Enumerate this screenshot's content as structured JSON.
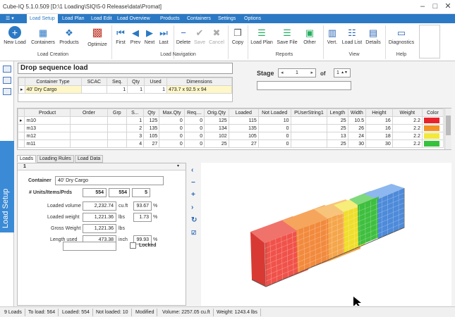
{
  "window": {
    "title": "Cube-IQ  5.1.0.509  [D:\\1 Loading\\SIQ\\5-0 Release\\data\\Promat]"
  },
  "tabs": [
    "Load Setup",
    "Load Plan",
    "Load Edit",
    "Load Overview",
    "Products",
    "Containers",
    "Settings",
    "Options"
  ],
  "ribbon": {
    "new_load": "New Load",
    "containers": "Containers",
    "products": "Products",
    "optimize": "Optimize",
    "first": "First",
    "prev": "Prev",
    "next": "Next",
    "last": "Last",
    "delete": "Delete",
    "save": "Save",
    "cancel": "Cancel",
    "copy": "Copy",
    "load_plan": "Load Plan",
    "save_file": "Save File",
    "other": "Other",
    "vert": "Vert.",
    "load_list": "Load List",
    "details": "Details",
    "diagnostics": "Diagnostics",
    "groups": {
      "load_creation": "Load Creation",
      "load_navigation": "Load Navigation",
      "reports": "Reports",
      "view": "View",
      "help": "Help"
    }
  },
  "sidebar": {
    "label": "Load Setup"
  },
  "sequence": {
    "title": "Drop sequence load",
    "stage_label": "Stage",
    "stage_value": "1",
    "of_label": "of",
    "of_value": "1"
  },
  "container_table": {
    "headers": [
      "Container Type",
      "SCAC",
      "Seq.",
      "Qty",
      "Used",
      "Dimensions"
    ],
    "rows": [
      [
        "40' Dry Cargo",
        "",
        "1",
        "1",
        "1",
        "473.7 x 92.5 x 94"
      ]
    ]
  },
  "product_table": {
    "headers": [
      "Product",
      "Order",
      "Grp",
      "S...",
      "Qty",
      "Max.Qty",
      "Req....",
      "Orig.Qty",
      "Loaded",
      "Not Loaded",
      "PUserString1",
      "Length",
      "Width",
      "Height",
      "Weight",
      "Color"
    ],
    "rows": [
      {
        "product": "m10",
        "order": "",
        "grp": "",
        "s": "1",
        "qty": "125",
        "maxqty": "0",
        "req": "0",
        "orig": "125",
        "loaded": "115",
        "notloaded": "10",
        "pus": "",
        "length": "25",
        "width": "10.5",
        "height": "16",
        "weight": "2.2",
        "color": "#e8232a"
      },
      {
        "product": "m13",
        "order": "",
        "grp": "",
        "s": "2",
        "qty": "135",
        "maxqty": "0",
        "req": "0",
        "orig": "134",
        "loaded": "135",
        "notloaded": "0",
        "pus": "",
        "length": "25",
        "width": "26",
        "height": "16",
        "weight": "2.2",
        "color": "#f39322"
      },
      {
        "product": "m12",
        "order": "",
        "grp": "",
        "s": "3",
        "qty": "105",
        "maxqty": "0",
        "req": "0",
        "orig": "102",
        "loaded": "105",
        "notloaded": "0",
        "pus": "",
        "length": "13",
        "width": "24",
        "height": "18",
        "weight": "2.2",
        "color": "#f2e93a"
      },
      {
        "product": "m11",
        "order": "",
        "grp": "",
        "s": "4",
        "qty": "27",
        "maxqty": "0",
        "req": "0",
        "orig": "25",
        "loaded": "27",
        "notloaded": "0",
        "pus": "",
        "length": "25",
        "width": "30",
        "height": "30",
        "weight": "2.2",
        "color": "#36c23c"
      }
    ]
  },
  "lower_tabs": [
    "Loads",
    "Loading Rules",
    "Load Data"
  ],
  "panel": {
    "index": "1",
    "container_label": "Container",
    "container_value": "40' Dry Cargo",
    "units_label": "# Units/Items/Prds",
    "units": [
      "554",
      "554",
      "5"
    ],
    "loaded_volume_label": "Loaded volume",
    "loaded_volume": "2,232.74",
    "loaded_volume_unit": "cu.ft",
    "loaded_volume_pct": "93.67",
    "pct": "%",
    "loaded_weight_label": "Loaded weight",
    "loaded_weight": "1,221.36",
    "loaded_weight_unit": "lbs",
    "loaded_weight_pct": "1.73",
    "gross_weight_label": "Gross Weight",
    "gross_weight": "1,221.36",
    "gross_weight_unit": "lbs",
    "length_used_label": "Length used",
    "length_used": "473.38",
    "length_used_unit": "inch",
    "length_used_pct": "99.93",
    "locked_label": "Locked"
  },
  "status": [
    "9 Loads",
    "To load: 564",
    "Loaded: 554",
    "Not loaded: 10",
    "Modified",
    "Volume: 2257.05 cu.ft",
    "Weight: 1243.4 lbs"
  ],
  "colors": {
    "accent": "#2b79c4"
  }
}
